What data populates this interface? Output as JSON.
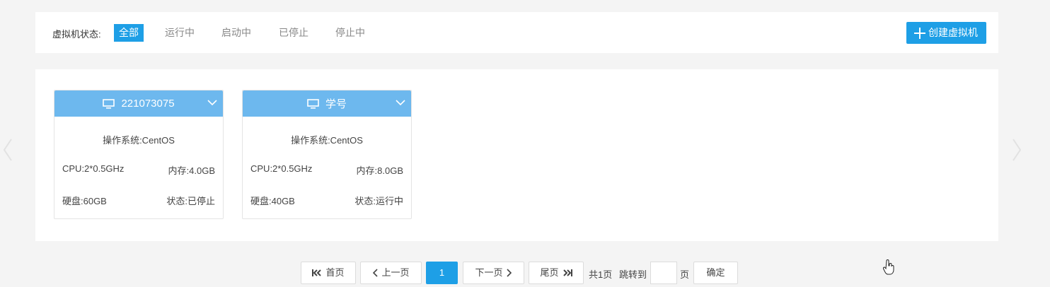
{
  "filter": {
    "label": "虚拟机状态:",
    "options": [
      "全部",
      "运行中",
      "启动中",
      "已停止",
      "停止中"
    ],
    "active_index": 0
  },
  "create_button": {
    "label": "创建虚拟机",
    "icon": "plus-icon"
  },
  "vms": [
    {
      "name": "221073075",
      "os": "操作系统:CentOS",
      "cpu": "CPU:2*0.5GHz",
      "memory": "内存:4.0GB",
      "disk": "硬盘:60GB",
      "status": "状态:已停止",
      "icon": "monitor-icon"
    },
    {
      "name": "学号",
      "os": "操作系统:CentOS",
      "cpu": "CPU:2*0.5GHz",
      "memory": "内存:8.0GB",
      "disk": "硬盘:40GB",
      "status": "状态:运行中",
      "icon": "monitor-icon"
    }
  ],
  "pagination": {
    "first": "首页",
    "prev": "上一页",
    "current": "1",
    "next": "下一页",
    "last": "尾页",
    "total": "共1页",
    "jump_label": "跳转到",
    "jump_value": "",
    "page_suffix": "页",
    "confirm": "确定"
  },
  "colors": {
    "accent": "#1e9fe6",
    "card_header": "#6db8ee",
    "background": "#f4f4f4"
  }
}
